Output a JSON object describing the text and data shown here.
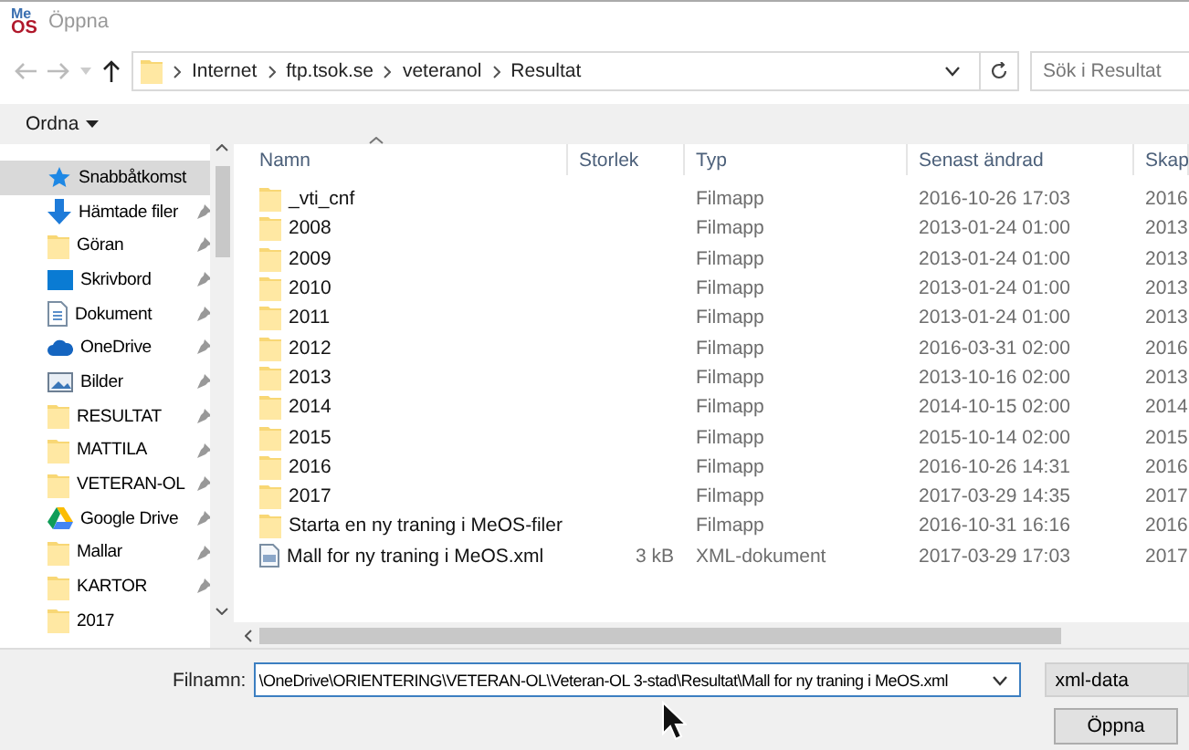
{
  "window": {
    "title": "Öppna",
    "logo": {
      "top": "Me",
      "bottom": "OS"
    }
  },
  "address_bar": {
    "path": [
      "Internet",
      "ftp.tsok.se",
      "veteranol",
      "Resultat"
    ]
  },
  "search": {
    "placeholder": "Sök i Resultat"
  },
  "toolbar": {
    "organize": "Ordna"
  },
  "sidebar": {
    "items": [
      {
        "label": "Snabbåtkomst",
        "kind": "star",
        "selected": true,
        "pinned": false
      },
      {
        "label": "Hämtade filer",
        "kind": "download",
        "selected": false,
        "pinned": true
      },
      {
        "label": "Göran",
        "kind": "folder",
        "selected": false,
        "pinned": true
      },
      {
        "label": "Skrivbord",
        "kind": "desktop",
        "selected": false,
        "pinned": true
      },
      {
        "label": "Dokument",
        "kind": "document",
        "selected": false,
        "pinned": true
      },
      {
        "label": "OneDrive",
        "kind": "cloud",
        "selected": false,
        "pinned": true
      },
      {
        "label": "Bilder",
        "kind": "pictures",
        "selected": false,
        "pinned": true
      },
      {
        "label": "RESULTAT",
        "kind": "folder",
        "selected": false,
        "pinned": true
      },
      {
        "label": "MATTILA",
        "kind": "folder",
        "selected": false,
        "pinned": true
      },
      {
        "label": "VETERAN-OL",
        "kind": "folder",
        "selected": false,
        "pinned": true
      },
      {
        "label": "Google Drive",
        "kind": "drive",
        "selected": false,
        "pinned": true
      },
      {
        "label": "Mallar",
        "kind": "folder",
        "selected": false,
        "pinned": true
      },
      {
        "label": "KARTOR",
        "kind": "folder",
        "selected": false,
        "pinned": true
      },
      {
        "label": "2017",
        "kind": "folder",
        "selected": false,
        "pinned": false
      }
    ]
  },
  "table": {
    "columns": [
      "Namn",
      "Storlek",
      "Typ",
      "Senast ändrad",
      "Skap"
    ],
    "rows": [
      {
        "kind": "folder",
        "cells": [
          "_vti_cnf",
          "",
          "Filmapp",
          "2016-10-26 17:03",
          "2016"
        ]
      },
      {
        "kind": "folder",
        "cells": [
          "2008",
          "",
          "Filmapp",
          "2013-01-24 01:00",
          "2013"
        ]
      },
      {
        "kind": "folder",
        "cells": [
          "2009",
          "",
          "Filmapp",
          "2013-01-24 01:00",
          "2013"
        ]
      },
      {
        "kind": "folder",
        "cells": [
          "2010",
          "",
          "Filmapp",
          "2013-01-24 01:00",
          "2013"
        ]
      },
      {
        "kind": "folder",
        "cells": [
          "2011",
          "",
          "Filmapp",
          "2013-01-24 01:00",
          "2013"
        ]
      },
      {
        "kind": "folder",
        "cells": [
          "2012",
          "",
          "Filmapp",
          "2016-03-31 02:00",
          "2016"
        ]
      },
      {
        "kind": "folder",
        "cells": [
          "2013",
          "",
          "Filmapp",
          "2013-10-16 02:00",
          "2013"
        ]
      },
      {
        "kind": "folder",
        "cells": [
          "2014",
          "",
          "Filmapp",
          "2014-10-15 02:00",
          "2014"
        ]
      },
      {
        "kind": "folder",
        "cells": [
          "2015",
          "",
          "Filmapp",
          "2015-10-14 02:00",
          "2015"
        ]
      },
      {
        "kind": "folder",
        "cells": [
          "2016",
          "",
          "Filmapp",
          "2016-10-26 14:31",
          "2016"
        ]
      },
      {
        "kind": "folder",
        "cells": [
          "2017",
          "",
          "Filmapp",
          "2017-03-29 14:35",
          "2017"
        ]
      },
      {
        "kind": "folder",
        "cells": [
          "Starta en ny traning i MeOS-filer",
          "",
          "Filmapp",
          "2016-10-31 16:16",
          "2016"
        ]
      },
      {
        "kind": "xml",
        "cells": [
          "Mall for ny traning i MeOS.xml",
          "3 kB",
          "XML-dokument",
          "2017-03-29 17:03",
          "2017"
        ]
      }
    ]
  },
  "filename": {
    "label": "Filnamn:",
    "value": "\\OneDrive\\ORIENTERING\\VETERAN-OL\\Veteran-OL 3-stad\\Resultat\\Mall for ny traning i MeOS.xml"
  },
  "filter": {
    "value": "xml-data"
  },
  "buttons": [
    "Öppna"
  ]
}
